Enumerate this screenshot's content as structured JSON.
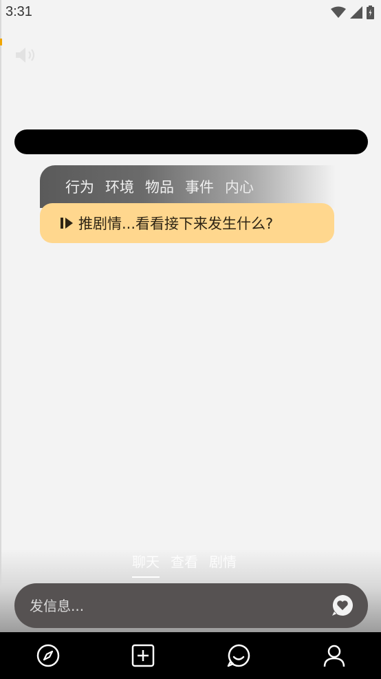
{
  "status_bar": {
    "time": "3:31"
  },
  "category_tabs": [
    "行为",
    "环境",
    "物品",
    "事件",
    "内心"
  ],
  "suggestion": {
    "text": "推剧情...看看接下来发生什么?"
  },
  "chat_tabs": [
    {
      "label": "聊天",
      "active": true
    },
    {
      "label": "查看",
      "active": false
    },
    {
      "label": "剧情",
      "active": false
    }
  ],
  "input": {
    "placeholder": "发信息..."
  },
  "nav": {
    "items": [
      "compass-icon",
      "add-square-icon",
      "chat-icon",
      "profile-icon"
    ]
  },
  "colors": {
    "background": "#f3f3f3",
    "suggestion_bg": "#ffd78e",
    "input_bg": "#565252",
    "nav_bg": "#000000"
  }
}
